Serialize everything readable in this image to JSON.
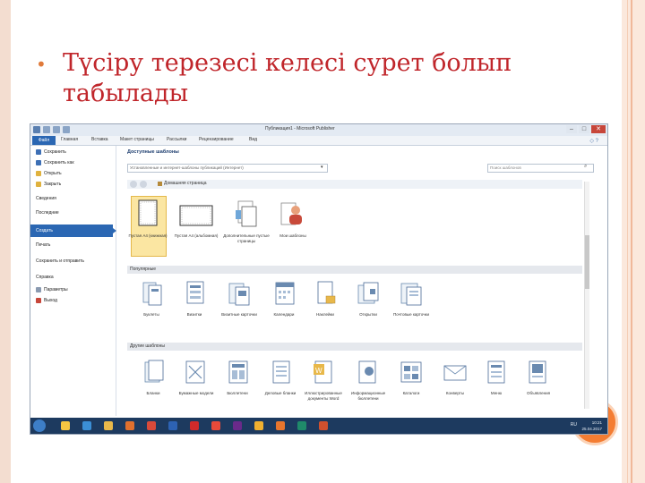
{
  "slide": {
    "title_line1": "Түсіру терезесі келесі сурет болып",
    "title_line2": "табылады",
    "bullet": "•"
  },
  "window": {
    "title": "Публикация1 - Microsoft Publisher",
    "tabs": [
      "Файл",
      "Главная",
      "Вставка",
      "Макет страницы",
      "Рассылки",
      "Рецензирование",
      "Вид"
    ],
    "controls": {
      "minimize": "–",
      "maximize": "□",
      "close": "✕"
    },
    "help": "◇ ?"
  },
  "sidebar": {
    "items": [
      {
        "label": "Сохранить",
        "icon": "save-icon"
      },
      {
        "label": "Сохранить как",
        "icon": "save-as-icon"
      },
      {
        "label": "Открыть",
        "icon": "open-folder-icon"
      },
      {
        "label": "Закрыть",
        "icon": "close-folder-icon"
      }
    ],
    "sections": [
      "Сведения",
      "Последние"
    ],
    "selected": "Создать",
    "sections2": [
      "Печать",
      "Сохранить и отправить",
      "Справка"
    ],
    "bottom_items": [
      {
        "label": "Параметры",
        "icon": "options-icon"
      },
      {
        "label": "Выход",
        "icon": "exit-icon"
      }
    ]
  },
  "main": {
    "heading": "Доступные шаблоны",
    "select_value": "Установленные и интернет-шаблоны публикаций (Интернет)",
    "search_placeholder": "Поиск шаблонов",
    "home_label": "Домашняя страница",
    "top_tiles": [
      {
        "label": "Пустая А4 (книжная)",
        "icon": "blank-portrait-icon"
      },
      {
        "label": "Пустая А4 (альбомная)",
        "icon": "blank-landscape-icon"
      },
      {
        "label": "Дополнительные пустые страницы",
        "icon": "more-blank-pages-icon"
      },
      {
        "label": "Мои шаблоны",
        "icon": "my-templates-icon"
      }
    ],
    "section_popular": "Популярные",
    "popular": [
      "Буклеты",
      "Визитки",
      "Визитные карточки",
      "Календари",
      "Наклейки",
      "Открытки",
      "Почтовые карточки"
    ],
    "section_other": "Другие шаблоны",
    "other": [
      "Бланки",
      "Бумажные модели",
      "Бюллетени",
      "Деловые бланки",
      "Иллюстрированные документы Word",
      "Информационные бюллетени",
      "Каталоги",
      "Конверты",
      "Меню",
      "Объявления"
    ]
  },
  "taskbar": {
    "apps": [
      {
        "name": "explorer-icon",
        "color": "#f5c542"
      },
      {
        "name": "ie-icon",
        "color": "#3b8fd6"
      },
      {
        "name": "folder-icon",
        "color": "#e8b84a"
      },
      {
        "name": "media-icon",
        "color": "#e0702e"
      },
      {
        "name": "chrome-icon",
        "color": "#d94a3a"
      },
      {
        "name": "word-icon",
        "color": "#2d62b3"
      },
      {
        "name": "opera-icon",
        "color": "#d12a2a"
      },
      {
        "name": "yandex-icon",
        "color": "#e84a3a"
      },
      {
        "name": "premiere-icon",
        "color": "#6a2a8a"
      },
      {
        "name": "yandex-browser-icon",
        "color": "#f0b030"
      },
      {
        "name": "firefox-icon",
        "color": "#e8762e"
      },
      {
        "name": "publisher-icon",
        "color": "#1f8a6a"
      },
      {
        "name": "powerpoint-icon",
        "color": "#d0502e"
      }
    ],
    "tray": "RU",
    "time": "10:21",
    "date": "25.04.2017"
  }
}
